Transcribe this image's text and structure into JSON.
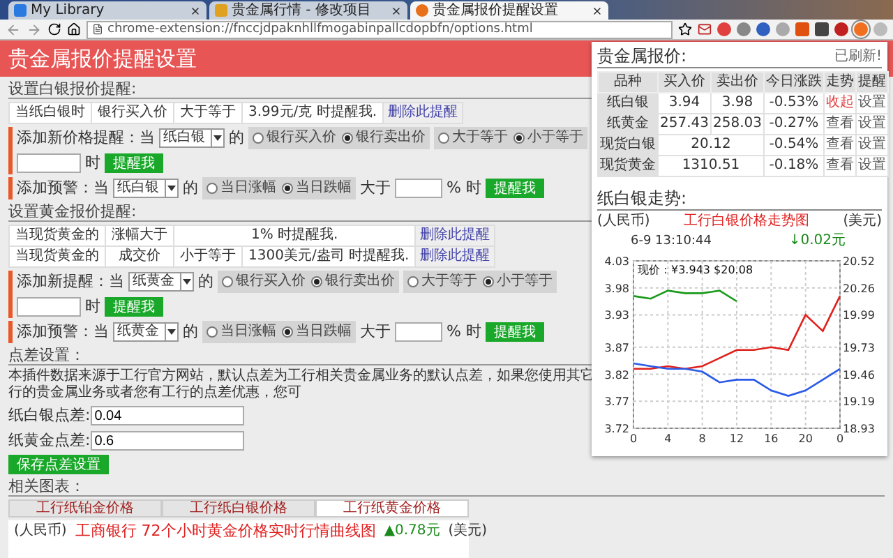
{
  "browser": {
    "tabs": [
      {
        "title": "My Library",
        "selected": false
      },
      {
        "title": "贵金属行情 - 修改项目",
        "selected": false
      },
      {
        "title": "贵金属报价提醒设置",
        "selected": true
      }
    ],
    "url": "chrome-extension://fnccjdpaknhllfmogabinpallcdopbfn/options.html"
  },
  "header": {
    "title": "贵金属报价提醒设置"
  },
  "sections": [
    {
      "title": "设置白银报价提醒:",
      "alerts": [
        {
          "cells": [
            "当纸白银时",
            "银行买入价",
            "大于等于",
            "3.99元/克 时提醒我."
          ],
          "action": "删除此提醒"
        }
      ],
      "forms": [
        {
          "label": "添加新价格提醒：当",
          "product": "纸白银",
          "of": "的",
          "groups": [
            [
              {
                "label": "银行买入价",
                "selected": false
              },
              {
                "label": "银行卖出价",
                "selected": true
              }
            ],
            [
              {
                "label": "大于等于",
                "selected": false
              },
              {
                "label": "小于等于",
                "selected": true
              }
            ]
          ],
          "suffix": "时",
          "button": "提醒我"
        },
        {
          "label": "添加预警：当",
          "product": "纸白银",
          "of": "的",
          "groups": [
            [
              {
                "label": "当日涨幅",
                "selected": false
              },
              {
                "label": "当日跌幅",
                "selected": true
              }
            ]
          ],
          "compare": "大于",
          "suffix": "% 时",
          "button": "提醒我"
        }
      ]
    },
    {
      "title": "设置黄金报价提醒:",
      "alerts": [
        {
          "cells": [
            "当现货黄金的",
            "涨幅大于",
            "1% 时提醒我."
          ],
          "action": "删除此提醒"
        },
        {
          "cells": [
            "当现货黄金的",
            "成交价",
            "小于等于",
            "1300美元/盎司 时提醒我."
          ],
          "action": "删除此提醒"
        }
      ],
      "forms": [
        {
          "label": "添加新提醒：当",
          "product": "纸黄金",
          "of": "的",
          "groups": [
            [
              {
                "label": "银行买入价",
                "selected": false
              },
              {
                "label": "银行卖出价",
                "selected": true
              }
            ],
            [
              {
                "label": "大于等于",
                "selected": false
              },
              {
                "label": "小于等于",
                "selected": true
              }
            ]
          ],
          "suffix": "时",
          "button": "提醒我"
        },
        {
          "label": "添加预警：当",
          "product": "纸黄金",
          "of": "的",
          "groups": [
            [
              {
                "label": "当日涨幅",
                "selected": false
              },
              {
                "label": "当日跌幅",
                "selected": true
              }
            ]
          ],
          "compare": "大于",
          "suffix": "% 时",
          "button": "提醒我"
        }
      ]
    }
  ],
  "spread": {
    "title": "点差设置：",
    "description": "本插件数据来源于工行官方网站，默认点差为工行相关贵金属业务的默认点差，如果您使用其它行的贵金属业务或者您有工行的点差优惠，您可",
    "fields": [
      {
        "label": "纸白银点差:",
        "value": "0.04"
      },
      {
        "label": "纸黄金点差:",
        "value": "0.6"
      }
    ],
    "button": "保存点差设置"
  },
  "charts": {
    "title": "相关图表：",
    "tabs": [
      {
        "label": "工行纸铂金价格",
        "selected": false
      },
      {
        "label": "工行纸白银价格",
        "selected": false
      },
      {
        "label": "工行纸黄金价格",
        "selected": true
      }
    ],
    "preview": {
      "left_unit": "(人民币)",
      "title": "工商银行 72个小时黄金价格实时行情曲线图",
      "change": "▲0.78元",
      "right_unit": "(美元)"
    }
  },
  "popup": {
    "title": "贵金属报价:",
    "status": "已刷新!",
    "columns": [
      "品种",
      "买入价",
      "卖出价",
      "今日涨跌",
      "走势",
      "提醒"
    ],
    "rows": [
      {
        "name": "纸白银",
        "buy": "3.94",
        "sell": "3.98",
        "change": "-0.53%",
        "trend": "收起",
        "expanded": true,
        "alert": "设置"
      },
      {
        "name": "纸黄金",
        "buy": "257.43",
        "sell": "258.03",
        "change": "-0.27%",
        "trend": "查看",
        "expanded": false,
        "alert": "设置"
      },
      {
        "name": "现货白银",
        "price": "20.12",
        "change": "-0.54%",
        "trend": "查看",
        "expanded": false,
        "alert": "设置"
      },
      {
        "name": "现货黄金",
        "price": "1310.51",
        "change": "-0.18%",
        "trend": "查看",
        "expanded": false,
        "alert": "设置"
      }
    ],
    "trend_title": "纸白银走势:",
    "chart": {
      "left_unit": "(人民币)",
      "right_unit": "(美元)",
      "timestamp": "6-9 13:10:44",
      "current": "现价：¥3.943 $20.08",
      "change": "↓0.02元",
      "x_end_label": "0",
      "right_ticks": [
        "20.52",
        "20.26",
        "19.99",
        "19.73",
        "19.46",
        "19.19",
        "18.93"
      ],
      "chart_data": {
        "type": "line",
        "title": "工行白银价格走势图",
        "x": [
          0,
          2,
          4,
          6,
          8,
          10,
          12,
          14,
          16,
          18,
          20,
          22,
          24
        ],
        "xlim": [
          0,
          24
        ],
        "ylim": [
          3.72,
          4.03
        ],
        "xticks": [
          0,
          4,
          8,
          12,
          16,
          20
        ],
        "grid": true,
        "yticks": [
          4.03,
          3.98,
          3.93,
          3.87,
          3.82,
          3.77,
          3.72
        ],
        "series": [
          {
            "color": "#1a9a1a",
            "values": [
              3.965,
              3.96,
              3.975,
              3.97,
              3.97,
              3.975,
              3.955,
              null,
              null,
              null,
              null,
              null,
              null
            ]
          },
          {
            "color": "#e0201a",
            "values": [
              3.83,
              3.83,
              3.835,
              3.83,
              3.835,
              3.85,
              3.865,
              3.865,
              3.87,
              3.865,
              3.93,
              3.9,
              3.965
            ]
          },
          {
            "color": "#2a5ae8",
            "values": [
              3.84,
              3.835,
              3.83,
              3.83,
              3.825,
              3.805,
              3.81,
              3.81,
              3.79,
              3.78,
              3.79,
              3.81,
              3.83
            ]
          }
        ]
      }
    }
  }
}
